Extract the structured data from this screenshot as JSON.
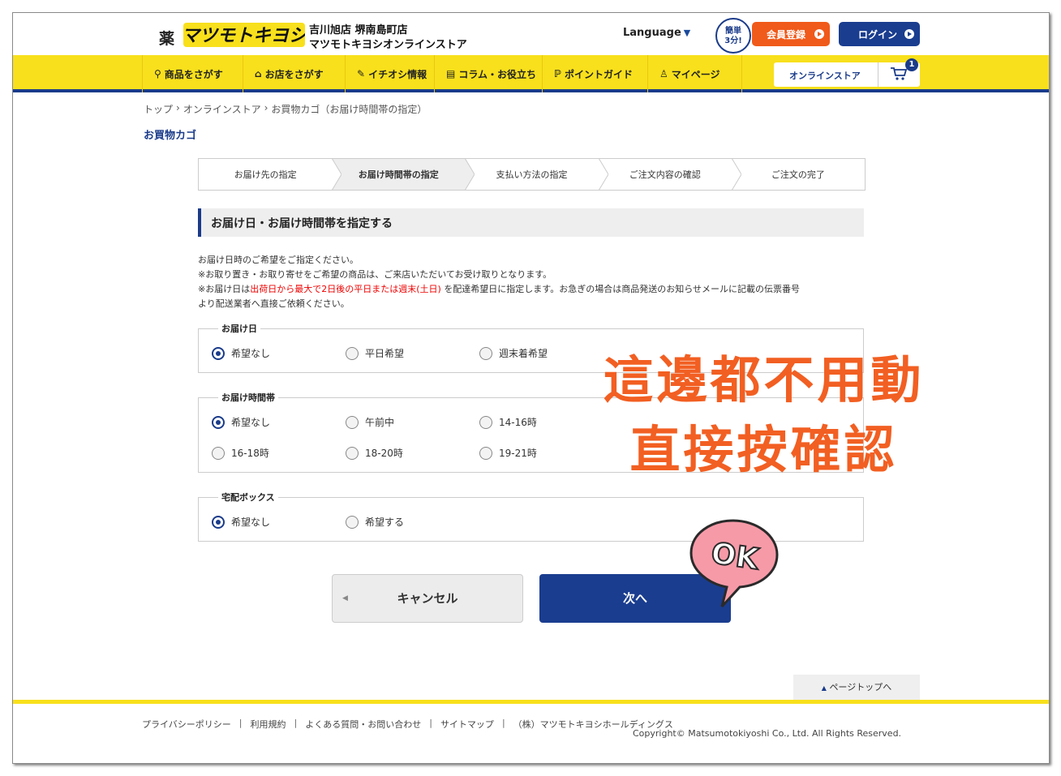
{
  "header": {
    "kusuri": "薬",
    "logo_text": "マツモトキヨシ",
    "store_line1": "吉川旭店 堺南島町店",
    "store_line2": "マツモトキヨシオンラインストア",
    "language": "Language",
    "easy_badge_line1": "簡単",
    "easy_badge_line2": "3分!",
    "register": "会員登録",
    "login": "ログイン"
  },
  "nav": {
    "items": [
      {
        "icon": "search-icon",
        "glyph": "⚲",
        "label": "商品をさがす"
      },
      {
        "icon": "shop-icon",
        "glyph": "⌂",
        "label": "お店をさがす"
      },
      {
        "icon": "recommend-icon",
        "glyph": "✎",
        "label": "イチオシ情報"
      },
      {
        "icon": "column-icon",
        "glyph": "▤",
        "label": "コラム・お役立ち"
      },
      {
        "icon": "point-icon",
        "glyph": "ℙ",
        "label": "ポイントガイド"
      },
      {
        "icon": "mypage-icon",
        "glyph": "♙",
        "label": "マイページ"
      }
    ],
    "online_store": "オンラインストア",
    "cart_count": "1"
  },
  "breadcrumb": [
    "トップ",
    "オンラインストア",
    "お買物カゴ（お届け時間帯の指定）"
  ],
  "page_title": "お買物カゴ",
  "steps": [
    {
      "label": "お届け先の指定",
      "active": false
    },
    {
      "label": "お届け時間帯の指定",
      "active": true
    },
    {
      "label": "支払い方法の指定",
      "active": false
    },
    {
      "label": "ご注文内容の確認",
      "active": false
    },
    {
      "label": "ご注文の完了",
      "active": false
    }
  ],
  "section_heading": "お届け日・お届け時間帯を指定する",
  "notes": {
    "line1": "お届け日時のご希望をご指定ください。",
    "line2": "※お取り置き・お取り寄せをご希望の商品は、ご来店いただいてお受け取りとなります。",
    "line3_a": "※お届け日は",
    "line3_red": "出荷日から最大で2日後の平日または週末(土日)",
    "line3_b": "を配達希望日に指定します。お急ぎの場合は商品発送のお知らせメールに記載の伝票番号",
    "line4": "より配送業者へ直接ご依頼ください。"
  },
  "delivery_date": {
    "legend": "お届け日",
    "options": [
      {
        "label": "希望なし",
        "selected": true
      },
      {
        "label": "平日希望",
        "selected": false
      },
      {
        "label": "週末着希望",
        "selected": false
      }
    ]
  },
  "delivery_time": {
    "legend": "お届け時間帯",
    "options": [
      {
        "label": "希望なし",
        "selected": true
      },
      {
        "label": "午前中",
        "selected": false
      },
      {
        "label": "14-16時",
        "selected": false
      },
      {
        "label": "16-18時",
        "selected": false
      },
      {
        "label": "18-20時",
        "selected": false
      },
      {
        "label": "19-21時",
        "selected": false
      }
    ]
  },
  "delivery_box": {
    "legend": "宅配ボックス",
    "options": [
      {
        "label": "希望なし",
        "selected": true
      },
      {
        "label": "希望する",
        "selected": false
      }
    ]
  },
  "buttons": {
    "cancel": "キャンセル",
    "next": "次へ"
  },
  "annotation": {
    "line1": "這邊都不用動",
    "line2": "直接按確認",
    "ok": "OK",
    "color": "#f25f22"
  },
  "footer": {
    "page_top": "ページトップへ",
    "links": [
      "プライバシーポリシー",
      "利用規約",
      "よくある質問・お問い合わせ",
      "サイトマップ"
    ],
    "company": "（株）マツモトキヨシホールディングス",
    "copyright": "Copyright© Matsumotokiyoshi Co., Ltd. All Rights Reserved."
  },
  "colors": {
    "brand_yellow": "#f8e01c",
    "brand_navy": "#1a3b8a",
    "register_orange": "#f05a1a"
  }
}
